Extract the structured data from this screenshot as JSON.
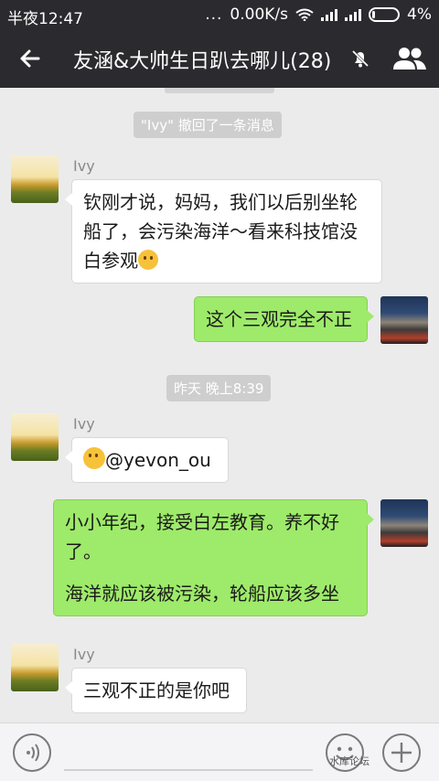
{
  "status_bar": {
    "time": "半夜12:47",
    "dots": "...",
    "speed": "0.00K/s",
    "battery": "4%"
  },
  "title_bar": {
    "title": "友涵&大帅生日趴去哪儿(28)"
  },
  "messages": {
    "recall_notice": "\"Ivy\" 撤回了一条消息",
    "m1": {
      "sender": "Ivy",
      "text": "钦刚才说，妈妈，我们以后别坐轮船了，会污染海洋～看来科技馆没白参观"
    },
    "m2": {
      "text": "这个三观完全不正"
    },
    "timestamp": "昨天 晚上8:39",
    "m3": {
      "sender": "Ivy",
      "text": "@yevon_ou"
    },
    "m4": {
      "line1": "小小年纪，接受白左教育。养不好了。",
      "line2": "海洋就应该被污染，轮船应该多坐"
    },
    "m5": {
      "sender": "Ivy",
      "text": "三观不正的是你吧"
    }
  },
  "watermark": "水库论坛",
  "colors": {
    "header_bg": "#2b2b2f",
    "chat_bg": "#ebebeb",
    "outgoing_bubble": "#9eea6a",
    "incoming_bubble": "#ffffff"
  }
}
